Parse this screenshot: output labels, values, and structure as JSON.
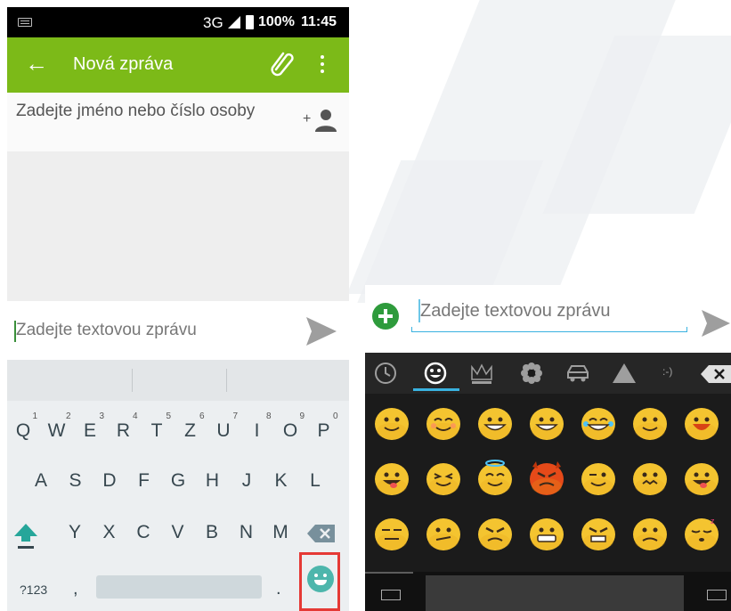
{
  "status_bar": {
    "network": "3G",
    "battery": "100%",
    "time": "11:45"
  },
  "app_bar": {
    "title": "Nová zpráva"
  },
  "recipient": {
    "placeholder": "Zadejte jméno nebo číslo osoby"
  },
  "compose": {
    "placeholder": "Zadejte textovou zprávu"
  },
  "keyboard": {
    "row1": [
      {
        "key": "Q",
        "hint": "1"
      },
      {
        "key": "W",
        "hint": "2"
      },
      {
        "key": "E",
        "hint": "3"
      },
      {
        "key": "R",
        "hint": "4"
      },
      {
        "key": "T",
        "hint": "5"
      },
      {
        "key": "Z",
        "hint": "6"
      },
      {
        "key": "U",
        "hint": "7"
      },
      {
        "key": "I",
        "hint": "8"
      },
      {
        "key": "O",
        "hint": "9"
      },
      {
        "key": "P",
        "hint": "0"
      }
    ],
    "row2": [
      "A",
      "S",
      "D",
      "F",
      "G",
      "H",
      "J",
      "K",
      "L"
    ],
    "row3": [
      "Y",
      "X",
      "C",
      "V",
      "B",
      "N",
      "M"
    ],
    "symbols_label": "?123",
    "comma": ",",
    "period": "."
  },
  "emoji_keyboard": {
    "categories": [
      "recent-icon",
      "smiley-icon",
      "crown-icon",
      "flower-icon",
      "car-icon",
      "triangle-icon",
      "emoticon-icon"
    ],
    "emoticon_label": ":-)",
    "selected_category": "smiley-icon",
    "emojis": [
      "smile",
      "blush",
      "grin",
      "grin-teeth",
      "laugh-tears",
      "smiley",
      "laugh-open",
      "tongue-wink",
      "squint-smile",
      "halo",
      "angry-devil",
      "wink",
      "worried-bite",
      "tongue",
      "expressionless",
      "confused",
      "angry",
      "grimace",
      "furious",
      "sad",
      "sleepy"
    ]
  },
  "colors": {
    "app_bar": "#7cba18",
    "emoji_key": "#4db6ac",
    "highlight": "#e53935",
    "accent": "#39b2e0"
  }
}
